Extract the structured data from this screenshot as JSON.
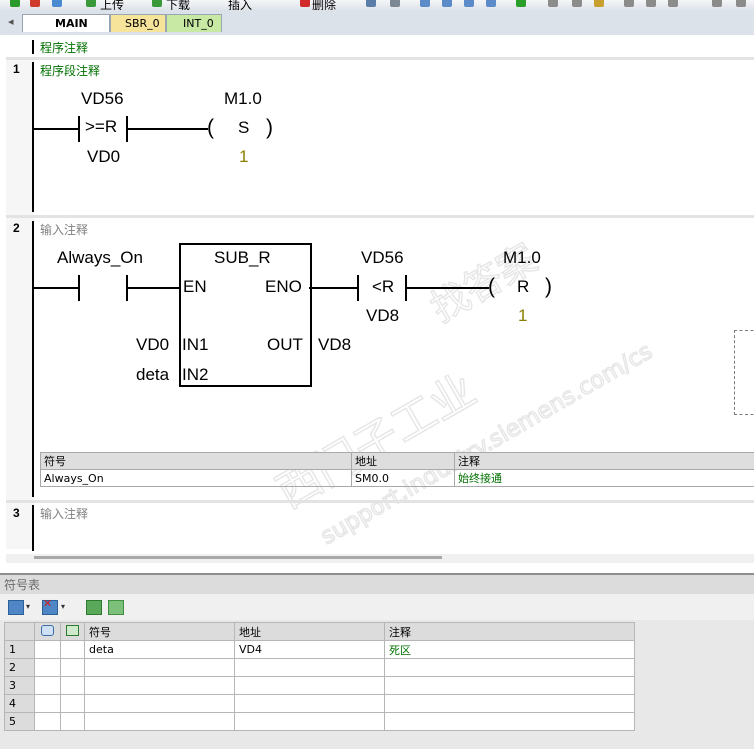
{
  "toolbar": {
    "upload_label": "上传",
    "download_label": "下载",
    "insert_label": "插入",
    "delete_label": "删除"
  },
  "tabs": [
    {
      "label": "MAIN",
      "active": true
    },
    {
      "label": "SBR_0",
      "active": false
    },
    {
      "label": "INT_0",
      "active": false
    }
  ],
  "tab_close": "×",
  "program_comment": "程序注释",
  "networks": [
    {
      "number": "1",
      "comment": "程序段注释",
      "compare_top": "VD56",
      "compare_op": ">=R",
      "compare_bottom": "VD0",
      "coil_top": "M1.0",
      "coil_op": "S",
      "coil_count": "1"
    },
    {
      "number": "2",
      "comment": "输入注释",
      "contact_label": "Always_On",
      "box_title": "SUB_R",
      "box_en": "EN",
      "box_eno": "ENO",
      "box_in1": "IN1",
      "box_in2": "IN2",
      "box_out": "OUT",
      "in1_operand": "VD0",
      "in2_operand": "deta",
      "out_operand": "VD8",
      "compare_top": "VD56",
      "compare_op": "<R",
      "compare_bottom": "VD8",
      "coil_top": "M1.0",
      "coil_op": "R",
      "coil_count": "1",
      "symbols": {
        "headers": [
          "符号",
          "地址",
          "注释"
        ],
        "rows": [
          [
            "Always_On",
            "SM0.0",
            "始终接通"
          ]
        ]
      }
    },
    {
      "number": "3",
      "comment": "输入注释"
    }
  ],
  "symbol_table": {
    "title": "符号表",
    "headers": [
      "符号",
      "地址",
      "注释"
    ],
    "rows": [
      {
        "num": "1",
        "symbol": "deta",
        "address": "VD4",
        "comment": "死区"
      },
      {
        "num": "2",
        "symbol": "",
        "address": "",
        "comment": ""
      },
      {
        "num": "3",
        "symbol": "",
        "address": "",
        "comment": ""
      },
      {
        "num": "4",
        "symbol": "",
        "address": "",
        "comment": ""
      },
      {
        "num": "5",
        "symbol": "",
        "address": "",
        "comment": ""
      }
    ]
  },
  "watermark": {
    "line1": "西门子工业",
    "line2": "找答案",
    "line3": "support.industry.siemens.com/cs"
  },
  "colors": {
    "comment_green": "#007000",
    "counter_olive": "#8a7f00",
    "gray_comment": "#808080"
  }
}
